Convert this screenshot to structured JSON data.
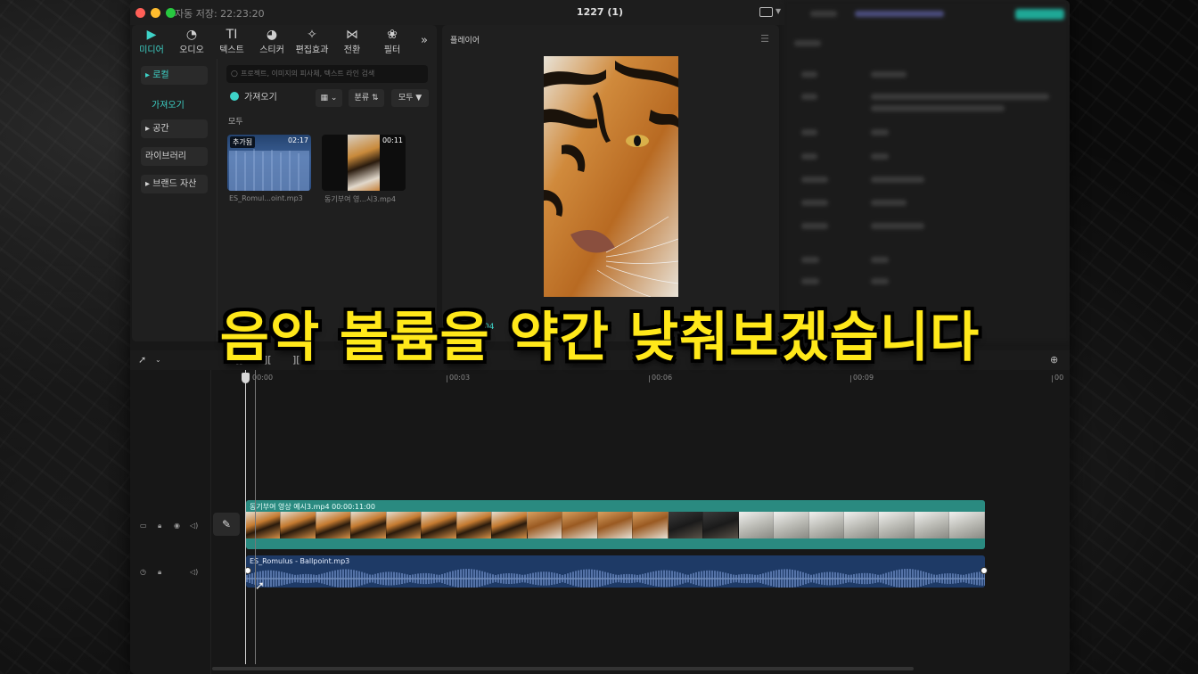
{
  "window": {
    "title": "1227 (1)",
    "autosave": "자동 저장: 22:23:20"
  },
  "media_tools": [
    {
      "label": "미디어",
      "icon": "media-icon",
      "glyph": "▶"
    },
    {
      "label": "오디오",
      "icon": "audio-icon",
      "glyph": "◔"
    },
    {
      "label": "텍스트",
      "icon": "text-icon",
      "glyph": "TI"
    },
    {
      "label": "스티커",
      "icon": "sticker-icon",
      "glyph": "◕"
    },
    {
      "label": "편집효과",
      "icon": "effects-icon",
      "glyph": "✧"
    },
    {
      "label": "전환",
      "icon": "transition-icon",
      "glyph": "⋈"
    },
    {
      "label": "필터",
      "icon": "filter-icon",
      "glyph": "❀"
    }
  ],
  "sidebar": {
    "local": "▸ 로컬",
    "import_sub": "가져오기",
    "space": "▸ 공간",
    "library": "라이브러리",
    "brand": "▸ 브랜드 자산"
  },
  "media": {
    "search_placeholder": "프로젝트, 이미지의 피사체, 텍스트 라인 검색",
    "import_button": "가져오기",
    "sort_label": "분류",
    "all_label": "모두",
    "section_all": "모두",
    "items": [
      {
        "badge": "추가됨",
        "duration": "02:17",
        "name": "ES_Romul...oint.mp3"
      },
      {
        "badge": "",
        "duration": "00:11",
        "name": "동기부여 영...시3.mp4"
      }
    ]
  },
  "player": {
    "title": "플레이어",
    "timecode_partial": ":04"
  },
  "timeline": {
    "ruler": [
      "00:00",
      "00:03",
      "00:06",
      "00:09",
      "00"
    ],
    "video_clip_label": "동기부여 영상 예시3.mp4   00:00:11:00",
    "audio_clip_label": "ES_Romulus - Ballpoint.mp3"
  },
  "subtitle": "음악 볼륨을 약간 낮춰보겠습니다",
  "colors": {
    "accent": "#3ed3c8",
    "video_clip": "#2a8a80",
    "audio_clip": "#1e3a66",
    "subtitle": "#ffe81a"
  }
}
